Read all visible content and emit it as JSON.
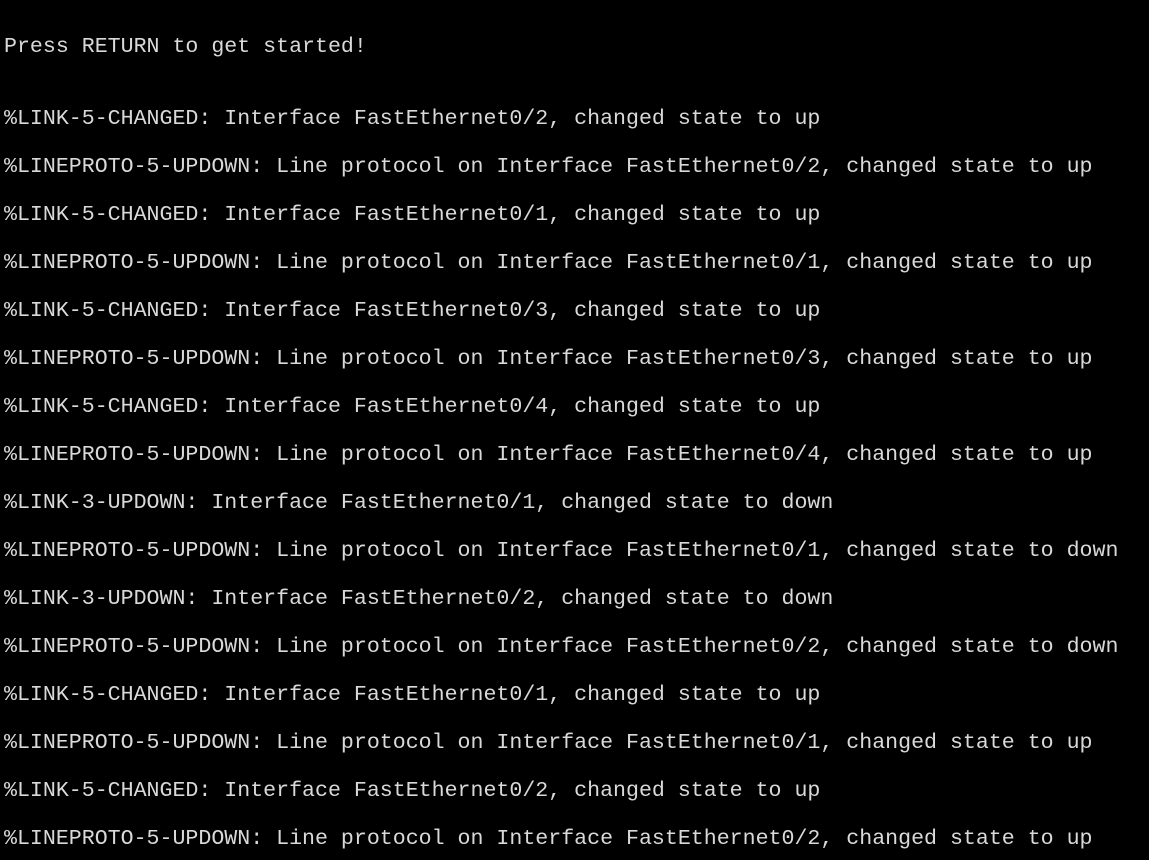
{
  "terminal": {
    "background": "#000000",
    "foreground": "#d9d9d9",
    "prompt": "Press RETURN to get started!",
    "log_lines": [
      "%LINK-5-CHANGED: Interface FastEthernet0/2, changed state to up",
      "%LINEPROTO-5-UPDOWN: Line protocol on Interface FastEthernet0/2, changed state to up",
      "%LINK-5-CHANGED: Interface FastEthernet0/1, changed state to up",
      "%LINEPROTO-5-UPDOWN: Line protocol on Interface FastEthernet0/1, changed state to up",
      "%LINK-5-CHANGED: Interface FastEthernet0/3, changed state to up",
      "%LINEPROTO-5-UPDOWN: Line protocol on Interface FastEthernet0/3, changed state to up",
      "%LINK-5-CHANGED: Interface FastEthernet0/4, changed state to up",
      "%LINEPROTO-5-UPDOWN: Line protocol on Interface FastEthernet0/4, changed state to up",
      "%LINK-3-UPDOWN: Interface FastEthernet0/1, changed state to down",
      "%LINEPROTO-5-UPDOWN: Line protocol on Interface FastEthernet0/1, changed state to down",
      "%LINK-3-UPDOWN: Interface FastEthernet0/2, changed state to down",
      "%LINEPROTO-5-UPDOWN: Line protocol on Interface FastEthernet0/2, changed state to down",
      "%LINK-5-CHANGED: Interface FastEthernet0/1, changed state to up",
      "%LINEPROTO-5-UPDOWN: Line protocol on Interface FastEthernet0/1, changed state to up",
      "%LINK-5-CHANGED: Interface FastEthernet0/2, changed state to up",
      "%LINEPROTO-5-UPDOWN: Line protocol on Interface FastEthernet0/2, changed state to up"
    ]
  }
}
